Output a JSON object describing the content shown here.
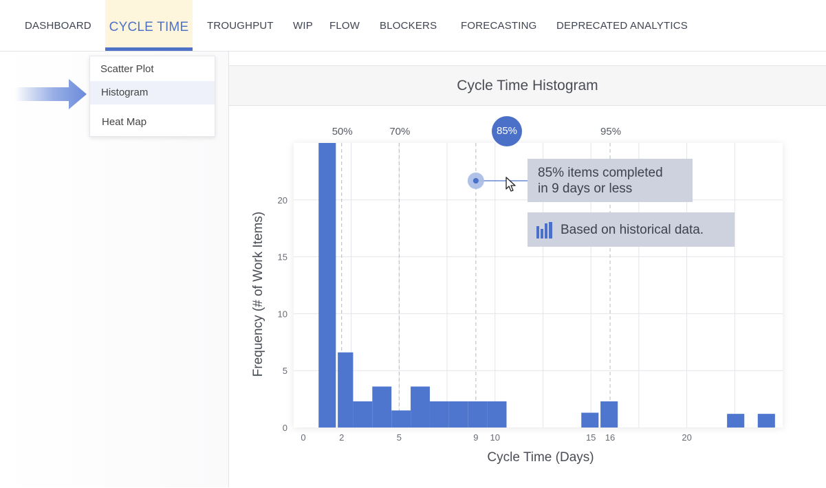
{
  "nav": {
    "items": [
      {
        "label": "DASHBOARD"
      },
      {
        "label": "CYCLE TIME"
      },
      {
        "label": "TROUGHPUT"
      },
      {
        "label": "WIP"
      },
      {
        "label": "FLOW"
      },
      {
        "label": "BLOCKERS"
      },
      {
        "label": "FORECASTING"
      },
      {
        "label": "DEPRECATED ANALYTICS"
      }
    ],
    "active": "CYCLE TIME"
  },
  "submenu": {
    "items": [
      {
        "label": "Scatter Plot"
      },
      {
        "label": "Histogram"
      },
      {
        "label": "Heat Map"
      }
    ],
    "selected": "Histogram"
  },
  "panel": {
    "title": "Cycle Time Histogram"
  },
  "tooltip": {
    "line1": "85% items completed",
    "line2": "in 9 days or less",
    "note": "Based on historical data.",
    "badge": "85%"
  },
  "icons": {
    "arrow": "pointer-arrow-icon",
    "note": "bar-chart-icon",
    "cursor": "mouse-cursor-icon"
  },
  "colors": {
    "accent": "#4f72c8",
    "bar": "#4f76cf",
    "tooltip_bg": "#cdd2de",
    "active_tab_bg": "#fdf6dc"
  },
  "chart_data": {
    "type": "bar",
    "title": "Cycle Time Histogram",
    "xlabel": "Cycle Time (Days)",
    "ylabel": "Frequency (# of Work Items)",
    "bins": [
      {
        "from": 0.8,
        "to": 1.7,
        "value": 25
      },
      {
        "from": 1.8,
        "to": 2.6,
        "value": 6.6
      },
      {
        "from": 2.6,
        "to": 3.6,
        "value": 2.3
      },
      {
        "from": 3.6,
        "to": 4.6,
        "value": 3.6
      },
      {
        "from": 4.6,
        "to": 5.6,
        "value": 1.5
      },
      {
        "from": 5.6,
        "to": 6.6,
        "value": 3.6
      },
      {
        "from": 6.6,
        "to": 7.6,
        "value": 2.3
      },
      {
        "from": 7.6,
        "to": 8.6,
        "value": 2.3
      },
      {
        "from": 8.6,
        "to": 9.6,
        "value": 2.3
      },
      {
        "from": 9.6,
        "to": 10.6,
        "value": 2.3
      },
      {
        "from": 14.5,
        "to": 15.4,
        "value": 1.3
      },
      {
        "from": 15.5,
        "to": 16.4,
        "value": 2.3
      },
      {
        "from": 22.1,
        "to": 23.0,
        "value": 1.2
      },
      {
        "from": 23.7,
        "to": 24.6,
        "value": 1.2
      }
    ],
    "xticks": [
      0,
      2,
      5,
      9,
      10,
      15,
      16,
      20
    ],
    "yticks": [
      0,
      5,
      10,
      15,
      20
    ],
    "xlim": [
      -0.5,
      25
    ],
    "ylim": [
      0,
      25
    ],
    "grid": true,
    "percentiles": [
      {
        "label": "50%",
        "x": 2
      },
      {
        "label": "70%",
        "x": 5
      },
      {
        "label": "85%",
        "x": 9
      },
      {
        "label": "95%",
        "x": 16
      }
    ]
  }
}
